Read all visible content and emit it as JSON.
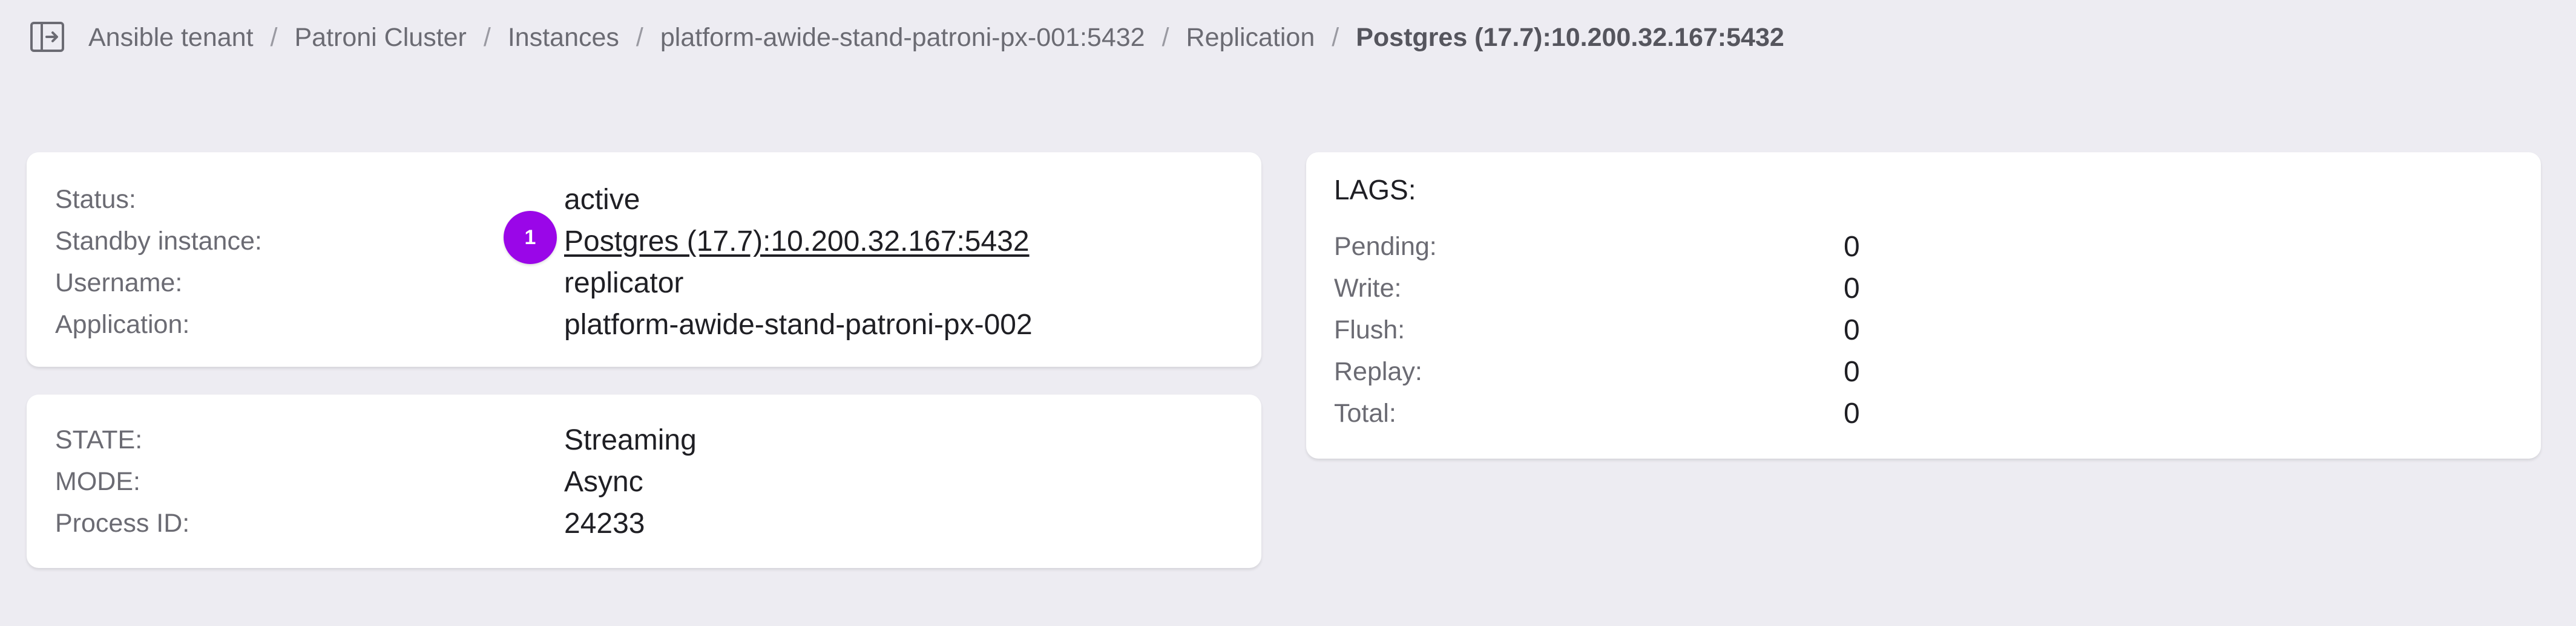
{
  "breadcrumb": {
    "items": [
      "Ansible tenant",
      "Patroni Cluster",
      "Instances",
      "platform-awide-stand-patroni-px-001:5432",
      "Replication"
    ],
    "current": "Postgres (17.7):10.200.32.167:5432",
    "separator": "/"
  },
  "replication": {
    "status_label": "Status:",
    "status_value": "active",
    "standby_label": "Standby instance:",
    "standby_value": "Postgres (17.7):10.200.32.167:5432",
    "standby_badge": "1",
    "username_label": "Username:",
    "username_value": "replicator",
    "application_label": "Application:",
    "application_value": "platform-awide-stand-patroni-px-002"
  },
  "state": {
    "state_label": "STATE:",
    "state_value": "Streaming",
    "mode_label": "MODE:",
    "mode_value": "Async",
    "pid_label": "Process ID:",
    "pid_value": "24233"
  },
  "lags": {
    "title": "LAGS:",
    "items": [
      {
        "label": "Pending:",
        "value": "0"
      },
      {
        "label": "Write:",
        "value": "0"
      },
      {
        "label": "Flush:",
        "value": "0"
      },
      {
        "label": "Replay:",
        "value": "0"
      },
      {
        "label": "Total:",
        "value": "0"
      }
    ]
  },
  "colors": {
    "background": "#edecf2",
    "card": "#ffffff",
    "badge": "#9a06e8",
    "label_text": "#6b6b73",
    "value_text": "#1f1f24"
  },
  "icons": {
    "sidebar_toggle": "sidebar-toggle-icon"
  }
}
